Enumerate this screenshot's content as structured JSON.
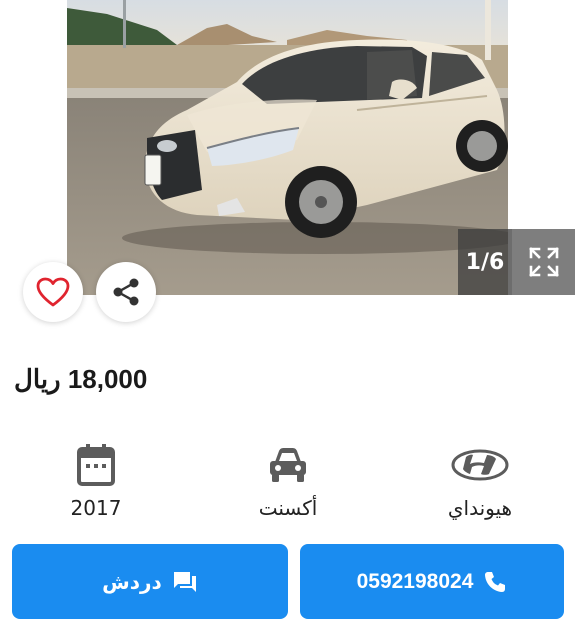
{
  "gallery": {
    "counter": "1/6",
    "image_alt": "car-photo"
  },
  "listing": {
    "price": "18,000 ريال"
  },
  "specs": {
    "year": "2017",
    "model": "أكسنت",
    "make": "هيونداي"
  },
  "actions": {
    "chat_label": "دردش",
    "phone_number": "0592198024"
  },
  "colors": {
    "accent": "#1a8cf0",
    "heart": "#e0242f",
    "icon_gray": "#5c5c5c"
  }
}
